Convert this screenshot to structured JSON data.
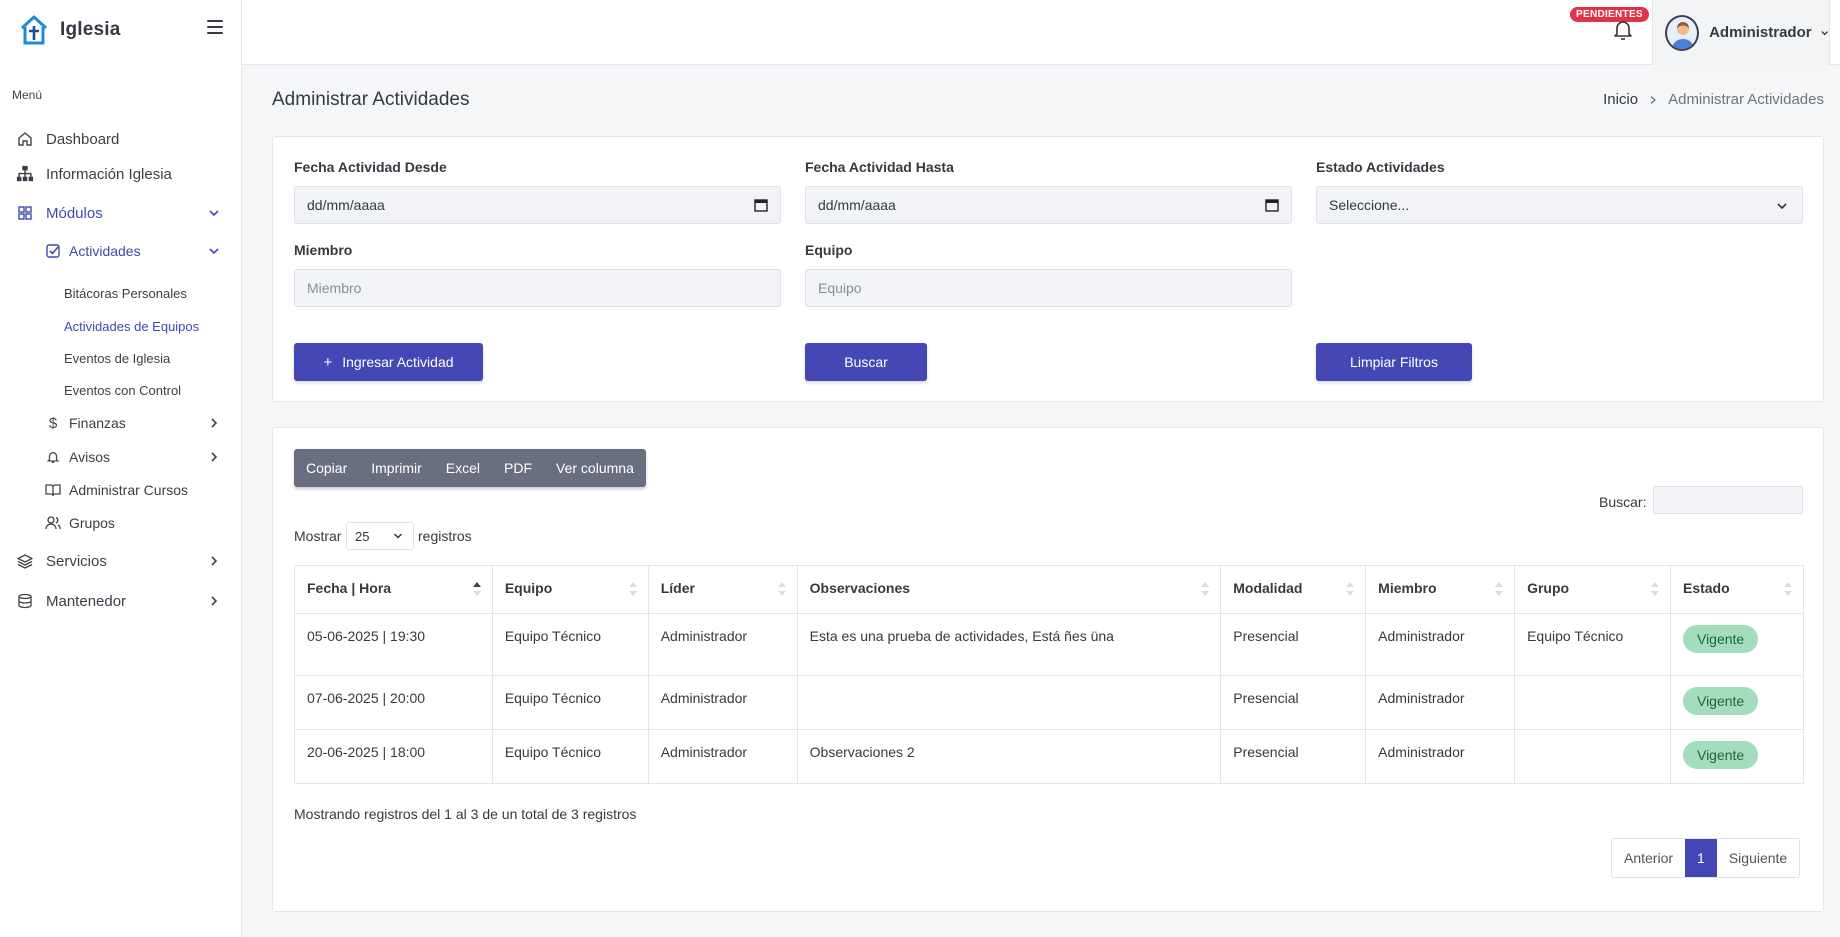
{
  "brand": {
    "name": "Iglesia"
  },
  "sidebar": {
    "menu_title": "Menú",
    "items": [
      {
        "label": "Dashboard"
      },
      {
        "label": "Información Iglesia"
      },
      {
        "label": "Módulos"
      },
      {
        "label": "Actividades"
      },
      {
        "label": "Bitácoras Personales"
      },
      {
        "label": "Actividades de Equipos"
      },
      {
        "label": "Eventos de Iglesia"
      },
      {
        "label": "Eventos con Control"
      },
      {
        "label": "Finanzas"
      },
      {
        "label": "Avisos"
      },
      {
        "label": "Administrar Cursos"
      },
      {
        "label": "Grupos"
      },
      {
        "label": "Servicios"
      },
      {
        "label": "Mantenedor"
      }
    ]
  },
  "header": {
    "notification_badge": "PENDIENTES",
    "user_name": "Administrador"
  },
  "page": {
    "title": "Administrar Actividades",
    "breadcrumb_home": "Inicio",
    "breadcrumb_current": "Administrar Actividades"
  },
  "filters": {
    "fecha_desde_label": "Fecha Actividad Desde",
    "fecha_desde_value": "dd/mm/aaaa",
    "fecha_hasta_label": "Fecha Actividad Hasta",
    "fecha_hasta_value": "dd/mm/aaaa",
    "estado_label": "Estado Actividades",
    "estado_value": "Seleccione...",
    "miembro_label": "Miembro",
    "miembro_placeholder": "Miembro",
    "equipo_label": "Equipo",
    "equipo_placeholder": "Equipo",
    "ingresar_button": "Ingresar Actividad",
    "buscar_button": "Buscar",
    "limpiar_button": "Limpiar Filtros"
  },
  "table_tools": {
    "export_buttons": [
      "Copiar",
      "Imprimir",
      "Excel",
      "PDF",
      "Ver columna"
    ],
    "search_label": "Buscar:",
    "show_label": "Mostrar",
    "show_value": "25",
    "show_suffix": "registros"
  },
  "table": {
    "columns": [
      "Fecha | Hora",
      "Equipo",
      "Líder",
      "Observaciones",
      "Modalidad",
      "Miembro",
      "Grupo",
      "Estado"
    ],
    "rows": [
      [
        "05-06-2025 | 19:30",
        "Equipo Técnico",
        "Administrador",
        "Esta es una prueba de actividades, Está ñes üna",
        "Presencial",
        "Administrador",
        "Equipo Técnico",
        "Vigente"
      ],
      [
        "07-06-2025 | 20:00",
        "Equipo Técnico",
        "Administrador",
        "",
        "Presencial",
        "Administrador",
        "",
        "Vigente"
      ],
      [
        "20-06-2025 | 18:00",
        "Equipo Técnico",
        "Administrador",
        "Observaciones 2",
        "Presencial",
        "Administrador",
        "",
        "Vigente"
      ]
    ]
  },
  "footer": {
    "info": "Mostrando registros del 1 al 3 de un total de 3 registros",
    "prev": "Anterior",
    "current_page": "1",
    "next": "Siguiente"
  },
  "colors": {
    "primary": "#4547b5",
    "success_badge": "#a4dcbe",
    "danger_badge": "#e0334a",
    "export_group": "#6a6f80"
  }
}
